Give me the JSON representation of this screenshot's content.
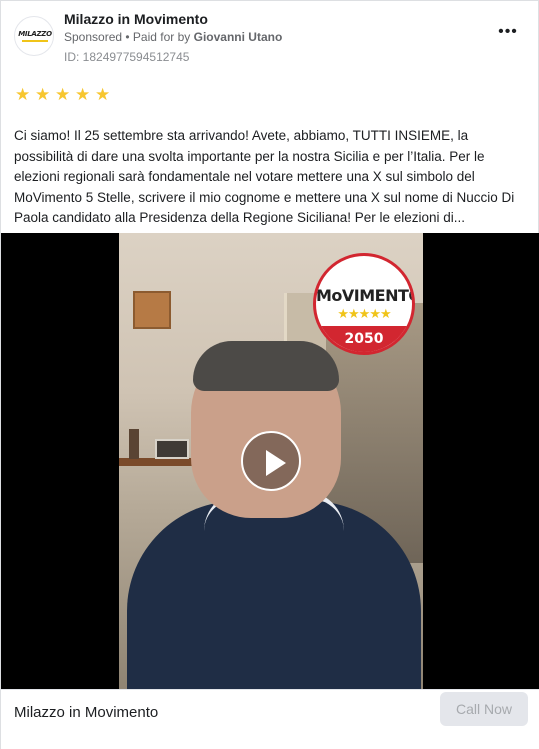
{
  "header": {
    "page_name": "Milazzo in Movimento",
    "avatar_text": "MILAZZO",
    "sponsored": "Sponsored",
    "paid_for_prefix": " • Paid for by ",
    "paid_for_name": "Giovanni Utano",
    "ad_id": "ID: 1824977594512745",
    "more_icon": "more-horizontal-icon",
    "more_label": "•••"
  },
  "rating": {
    "stars": 5,
    "star_glyph": "★",
    "color": "#f7c62f"
  },
  "post": {
    "text": "Ci siamo! Il 25 settembre sta arrivando! Avete, abbiamo, TUTTI INSIEME, la possibilità di dare una svolta importante per la nostra Sicilia e per l’Italia. Per le elezioni regionali sarà fondamentale nel votare mettere una X sul simbolo del MoVimento 5 Stelle, scrivere il mio cognome e mettere una X sul nome di Nuccio Di Paola candidato alla Presidenza della Regione Siciliana! Per le elezioni di..."
  },
  "video": {
    "logo_word": "MoVIMENTO",
    "logo_stars": "★★★★★",
    "logo_year": "2050",
    "play_icon": "play-icon"
  },
  "footer": {
    "page_name": "Milazzo in Movimento",
    "cta_label": "Call Now"
  },
  "colors": {
    "movimento_red": "#d22630",
    "star_yellow": "#f7c62f",
    "cta_bg": "#e4e6eb"
  }
}
